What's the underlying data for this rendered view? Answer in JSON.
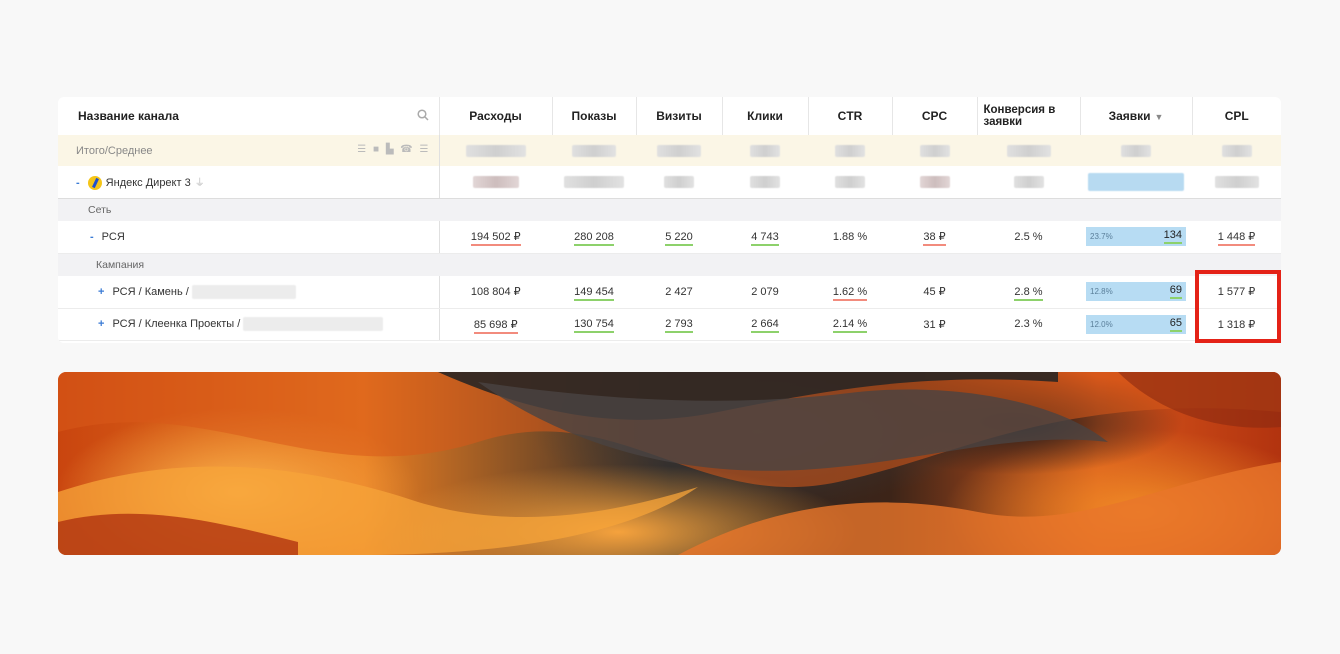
{
  "table": {
    "headers": {
      "name": "Название канала",
      "cols": [
        "Расходы",
        "Показы",
        "Визиты",
        "Клики",
        "CTR",
        "CPC",
        "Конверсия в заявки",
        "Заявки",
        "CPL"
      ]
    },
    "total_label": "Итого/Среднее",
    "channel_label": "Яндекс Директ 3",
    "group_network": "Сеть",
    "rsya": {
      "label": "РСЯ",
      "spend": "194 502 ₽",
      "impressions": "280 208",
      "visits": "5 220",
      "clicks": "4 743",
      "ctr": "1.88 %",
      "cpc": "38 ₽",
      "conv": "2.5 %",
      "leads_pct": "23.7%",
      "leads": "134",
      "cpl": "1 448 ₽"
    },
    "group_campaign": "Кампания",
    "rows": [
      {
        "label": "РСЯ / Камень /",
        "spend": "108 804 ₽",
        "impressions": "149 454",
        "visits": "2 427",
        "clicks": "2 079",
        "ctr": "1.62 %",
        "cpc": "45 ₽",
        "conv": "2.8 %",
        "leads_pct": "12.8%",
        "leads": "69",
        "cpl": "1 577 ₽"
      },
      {
        "label": "РСЯ / Клеенка Проекты /",
        "spend": "85 698 ₽",
        "impressions": "130 754",
        "visits": "2 793",
        "clicks": "2 664",
        "ctr": "2.14 %",
        "cpc": "31 ₽",
        "conv": "2.3 %",
        "leads_pct": "12.0%",
        "leads": "65",
        "cpl": "1 318 ₽"
      }
    ]
  },
  "colors": {
    "highlight": "#e42217",
    "bar": "#b7dcf3",
    "underline_red": "#f28b7d",
    "underline_green": "#8dd16b"
  }
}
